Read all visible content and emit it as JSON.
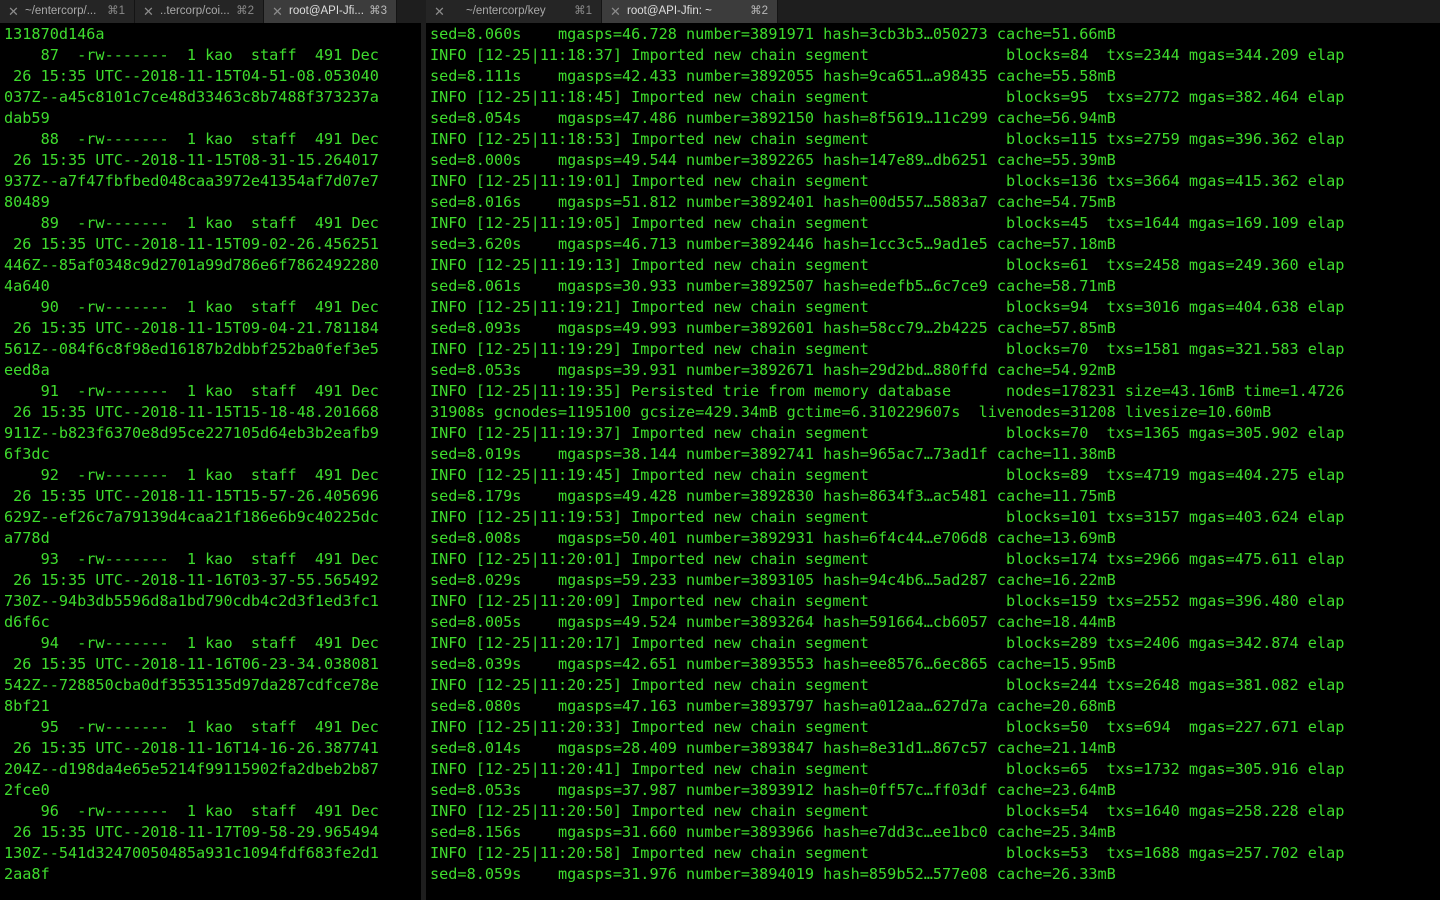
{
  "left_window": {
    "tabs": [
      {
        "title": "~/entercorp/...",
        "shortcut": "⌘1",
        "active": false
      },
      {
        "title": "..tercorp/coi...",
        "shortcut": "⌘2",
        "active": false
      },
      {
        "title": "root@API-Jfi...",
        "shortcut": "⌘3",
        "active": true
      }
    ],
    "lines": [
      "131870d146a",
      "    87  -rw-------  1 kao  staff  491 Dec",
      " 26 15:35 UTC--2018-11-15T04-51-08.053040",
      "037Z--a45c8101c7ce48d33463c8b7488f373237a",
      "dab59",
      "    88  -rw-------  1 kao  staff  491 Dec",
      " 26 15:35 UTC--2018-11-15T08-31-15.264017",
      "937Z--a7f47fbfbed048caa3972e41354af7d07e7",
      "80489",
      "    89  -rw-------  1 kao  staff  491 Dec",
      " 26 15:35 UTC--2018-11-15T09-02-26.456251",
      "446Z--85af0348c9d2701a99d786e6f7862492280",
      "4a640",
      "    90  -rw-------  1 kao  staff  491 Dec",
      " 26 15:35 UTC--2018-11-15T09-04-21.781184",
      "561Z--084f6c8f98ed16187b2dbbf252ba0fef3e5",
      "eed8a",
      "    91  -rw-------  1 kao  staff  491 Dec",
      " 26 15:35 UTC--2018-11-15T15-18-48.201668",
      "911Z--b823f6370e8d95ce227105d64eb3b2eafb9",
      "6f3dc",
      "    92  -rw-------  1 kao  staff  491 Dec",
      " 26 15:35 UTC--2018-11-15T15-57-26.405696",
      "629Z--ef26c7a79139d4caa21f186e6b9c40225dc",
      "a778d",
      "    93  -rw-------  1 kao  staff  491 Dec",
      " 26 15:35 UTC--2018-11-16T03-37-55.565492",
      "730Z--94b3db5596d8a1bd790cdb4c2d3f1ed3fc1",
      "d6f6c",
      "    94  -rw-------  1 kao  staff  491 Dec",
      " 26 15:35 UTC--2018-11-16T06-23-34.038081",
      "542Z--728850cba0df3535135d97da287cdfce78e",
      "8bf21",
      "    95  -rw-------  1 kao  staff  491 Dec",
      " 26 15:35 UTC--2018-11-16T14-16-26.387741",
      "204Z--d198da4e65e5214f99115902fa2dbeb2b87",
      "2fce0",
      "    96  -rw-------  1 kao  staff  491 Dec",
      " 26 15:35 UTC--2018-11-17T09-58-29.965494",
      "130Z--541d32470050485a931c1094fdf683fe2d1",
      "2aa8f"
    ]
  },
  "right_window": {
    "tabs": [
      {
        "title": "~/entercorp/key",
        "shortcut": "⌘1",
        "active": false
      },
      {
        "title": "root@API-Jfin: ~",
        "shortcut": "⌘2",
        "active": true
      }
    ],
    "lines": [
      "sed=8.060s    mgasps=46.728 number=3891971 hash=3cb3b3…050273 cache=51.66mB",
      "INFO [12-25|11:18:37] Imported new chain segment               blocks=84  txs=2344 mgas=344.209 elap",
      "sed=8.111s    mgasps=42.433 number=3892055 hash=9ca651…a98435 cache=55.58mB",
      "INFO [12-25|11:18:45] Imported new chain segment               blocks=95  txs=2772 mgas=382.464 elap",
      "sed=8.054s    mgasps=47.486 number=3892150 hash=8f5619…11c299 cache=56.94mB",
      "INFO [12-25|11:18:53] Imported new chain segment               blocks=115 txs=2759 mgas=396.362 elap",
      "sed=8.000s    mgasps=49.544 number=3892265 hash=147e89…db6251 cache=55.39mB",
      "INFO [12-25|11:19:01] Imported new chain segment               blocks=136 txs=3664 mgas=415.362 elap",
      "sed=8.016s    mgasps=51.812 number=3892401 hash=00d557…5883a7 cache=54.75mB",
      "INFO [12-25|11:19:05] Imported new chain segment               blocks=45  txs=1644 mgas=169.109 elap",
      "sed=3.620s    mgasps=46.713 number=3892446 hash=1cc3c5…9ad1e5 cache=57.18mB",
      "INFO [12-25|11:19:13] Imported new chain segment               blocks=61  txs=2458 mgas=249.360 elap",
      "sed=8.061s    mgasps=30.933 number=3892507 hash=edefb5…6c7ce9 cache=58.71mB",
      "INFO [12-25|11:19:21] Imported new chain segment               blocks=94  txs=3016 mgas=404.638 elap",
      "sed=8.093s    mgasps=49.993 number=3892601 hash=58cc79…2b4225 cache=57.85mB",
      "INFO [12-25|11:19:29] Imported new chain segment               blocks=70  txs=1581 mgas=321.583 elap",
      "sed=8.053s    mgasps=39.931 number=3892671 hash=29d2bd…880ffd cache=54.92mB",
      "INFO [12-25|11:19:35] Persisted trie from memory database      nodes=178231 size=43.16mB time=1.4726",
      "31908s gcnodes=1195100 gcsize=429.34mB gctime=6.310229607s  livenodes=31208 livesize=10.60mB",
      "INFO [12-25|11:19:37] Imported new chain segment               blocks=70  txs=1365 mgas=305.902 elap",
      "sed=8.019s    mgasps=38.144 number=3892741 hash=965ac7…73ad1f cache=11.38mB",
      "INFO [12-25|11:19:45] Imported new chain segment               blocks=89  txs=4719 mgas=404.275 elap",
      "sed=8.179s    mgasps=49.428 number=3892830 hash=8634f3…ac5481 cache=11.75mB",
      "INFO [12-25|11:19:53] Imported new chain segment               blocks=101 txs=3157 mgas=403.624 elap",
      "sed=8.008s    mgasps=50.401 number=3892931 hash=6f4c44…e706d8 cache=13.69mB",
      "INFO [12-25|11:20:01] Imported new chain segment               blocks=174 txs=2966 mgas=475.611 elap",
      "sed=8.029s    mgasps=59.233 number=3893105 hash=94c4b6…5ad287 cache=16.22mB",
      "INFO [12-25|11:20:09] Imported new chain segment               blocks=159 txs=2552 mgas=396.480 elap",
      "sed=8.005s    mgasps=49.524 number=3893264 hash=591664…cb6057 cache=18.44mB",
      "INFO [12-25|11:20:17] Imported new chain segment               blocks=289 txs=2406 mgas=342.874 elap",
      "sed=8.039s    mgasps=42.651 number=3893553 hash=ee8576…6ec865 cache=15.95mB",
      "INFO [12-25|11:20:25] Imported new chain segment               blocks=244 txs=2648 mgas=381.082 elap",
      "sed=8.080s    mgasps=47.163 number=3893797 hash=a012aa…627d7a cache=20.68mB",
      "INFO [12-25|11:20:33] Imported new chain segment               blocks=50  txs=694  mgas=227.671 elap",
      "sed=8.014s    mgasps=28.409 number=3893847 hash=8e31d1…867c57 cache=21.14mB",
      "INFO [12-25|11:20:41] Imported new chain segment               blocks=65  txs=1732 mgas=305.916 elap",
      "sed=8.053s    mgasps=37.987 number=3893912 hash=0ff57c…ff03df cache=23.64mB",
      "INFO [12-25|11:20:50] Imported new chain segment               blocks=54  txs=1640 mgas=258.228 elap",
      "sed=8.156s    mgasps=31.660 number=3893966 hash=e7dd3c…ee1bc0 cache=25.34mB",
      "INFO [12-25|11:20:58] Imported new chain segment               blocks=53  txs=1688 mgas=257.702 elap",
      "sed=8.059s    mgasps=31.976 number=3894019 hash=859b52…577e08 cache=26.33mB"
    ]
  }
}
